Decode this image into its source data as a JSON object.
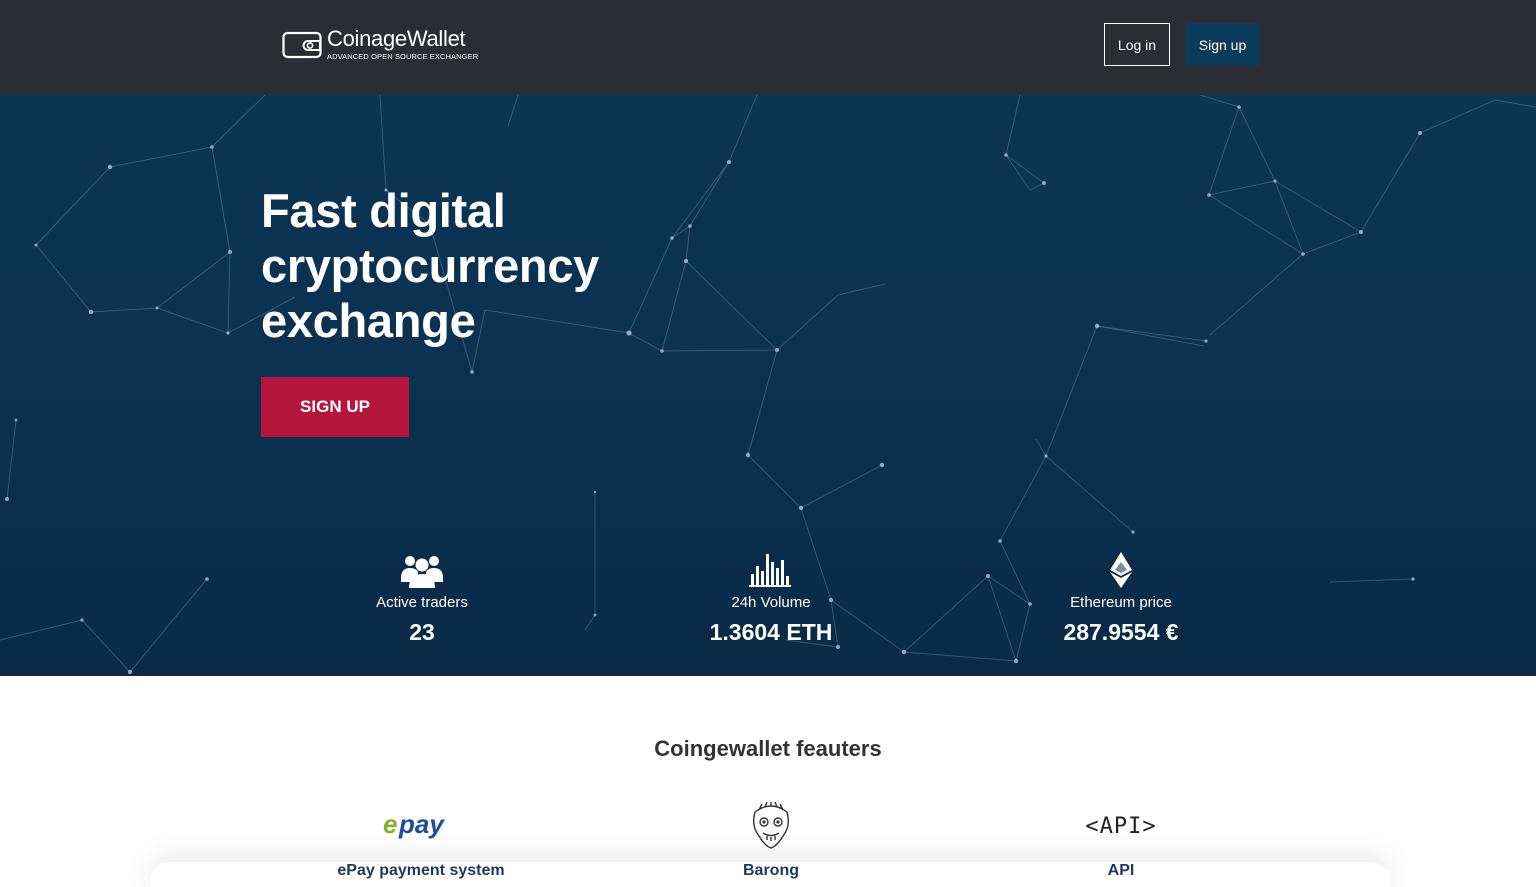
{
  "header": {
    "brand_name": "CoinageWallet",
    "brand_tagline": "ADVANCED OPEN SOURCE EXCHANGER",
    "login_label": "Log in",
    "signup_label": "Sign up",
    "background_color": "#2a2d33",
    "signup_color": "#0c3a5a"
  },
  "hero": {
    "title_lines": [
      "Fast digital",
      "cryptocurrency",
      "exchange"
    ],
    "cta_label": "SIGN UP",
    "cta_color": "#b5163c",
    "background_color": "#0b3150",
    "stats": [
      {
        "icon": "users-icon",
        "label": "Active traders",
        "value": "23"
      },
      {
        "icon": "bar-chart-icon",
        "label": "24h Volume",
        "value": "1.3604 ETH"
      },
      {
        "icon": "ethereum-icon",
        "label": "Ethereum price",
        "value": "287.9554 €"
      }
    ]
  },
  "features": {
    "title": "Coingewallet feauters",
    "items": [
      {
        "icon": "epay-logo-icon",
        "logo_text": "epay",
        "label": "ePay payment system"
      },
      {
        "icon": "barong-mask-icon",
        "label": "Barong"
      },
      {
        "icon": "api-icon",
        "logo_text": "<API>",
        "label": "API"
      }
    ]
  }
}
